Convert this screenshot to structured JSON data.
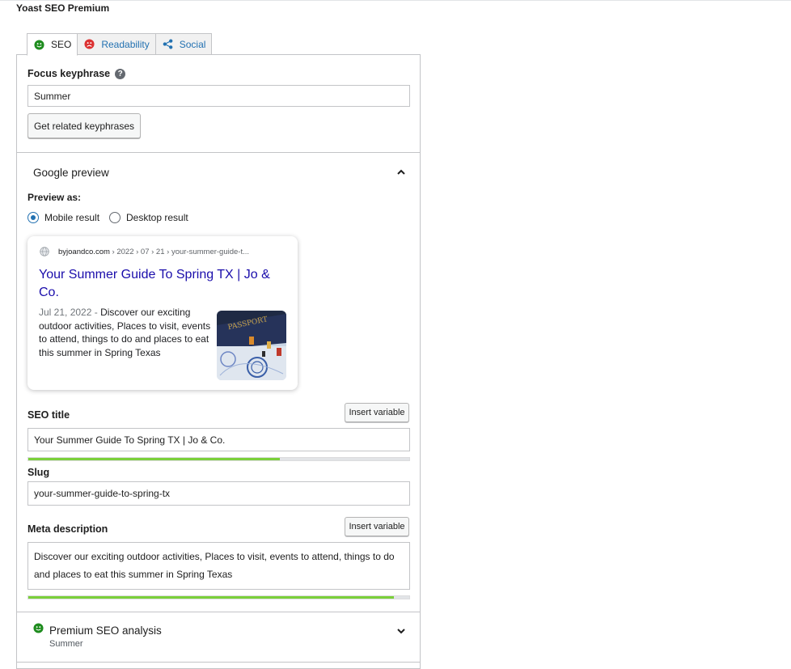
{
  "header": {
    "title": "Yoast SEO Premium"
  },
  "tabs": [
    {
      "label": "SEO",
      "icon": "smiley-good-icon",
      "active": true
    },
    {
      "label": "Readability",
      "icon": "smiley-bad-icon",
      "active": false
    },
    {
      "label": "Social",
      "icon": "share-icon",
      "active": false
    }
  ],
  "focus": {
    "label": "Focus keyphrase",
    "value": "Summer",
    "related_button": "Get related keyphrases"
  },
  "google_preview": {
    "section_title": "Google preview",
    "preview_as_label": "Preview as:",
    "options": [
      {
        "label": "Mobile result",
        "checked": true
      },
      {
        "label": "Desktop result",
        "checked": false
      }
    ],
    "result": {
      "domain": "byjoandco.com",
      "path": " › 2022 › 07 › 21 › your-summer-guide-t...",
      "title": "Your Summer Guide To Spring TX | Jo & Co.",
      "date": "Jul 21, 2022",
      "separator": " - ",
      "description": "Discover our exciting outdoor activities, Places to visit, events to attend, things to do and places to eat this summer in Spring Texas"
    }
  },
  "seo_title": {
    "label": "SEO title",
    "insert_button": "Insert variable",
    "value": "Your Summer Guide To Spring TX | Jo & Co.",
    "progress": 0.66
  },
  "slug": {
    "label": "Slug",
    "value": "your-summer-guide-to-spring-tx"
  },
  "meta_description": {
    "label": "Meta description",
    "insert_button": "Insert variable",
    "value": "Discover our exciting outdoor activities, Places to visit, events to attend, things to do and places to eat this summer in Spring Texas",
    "progress": 0.96
  },
  "premium_analysis": {
    "title": "Premium SEO analysis",
    "keyphrase": "Summer"
  },
  "colors": {
    "good": "#1e8c1e",
    "bad": "#dc3232",
    "link": "#2271b1",
    "progress": "#7ad03a",
    "serp_title": "#1a0dab"
  }
}
